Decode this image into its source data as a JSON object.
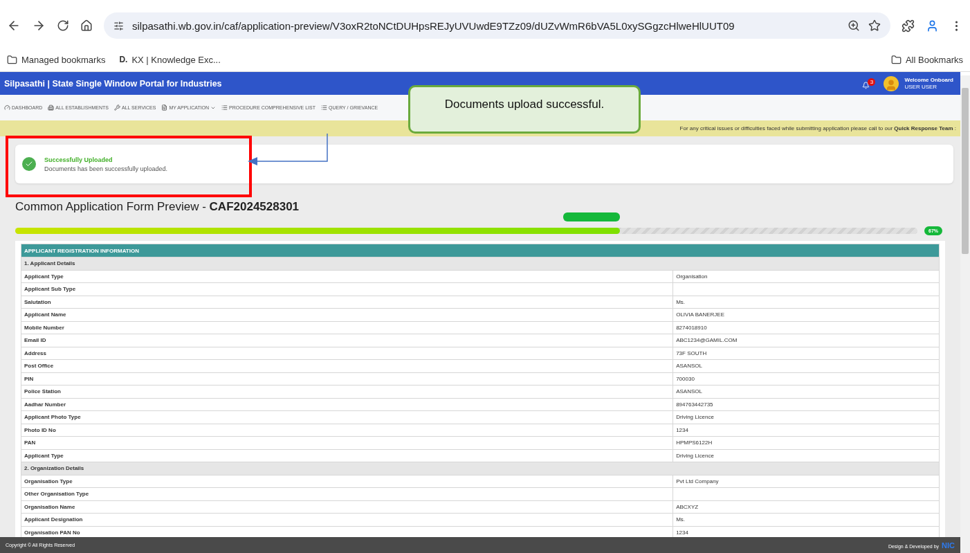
{
  "browser": {
    "url": "silpasathi.wb.gov.in/caf/application-preview/V3oxR2toNCtDUHpsREJyUVUwdE9TZz09/dUZvWmR6bVA5L0xySGgzcHlweHlUUT09",
    "bookmarks": [
      {
        "label": "Managed bookmarks",
        "kind": "folder"
      },
      {
        "label": "KX | Knowledge Exc...",
        "kind": "site",
        "logo_text": "D."
      }
    ],
    "all_bookmarks": "All Bookmarks"
  },
  "header": {
    "title": "Silpasathi | State Single Window Portal for Industries",
    "notification_count": "3",
    "welcome": "Welcome Onboard",
    "user": "USER USER"
  },
  "nav": [
    {
      "label": "DASHBOARD",
      "kind": "dashboard"
    },
    {
      "label": "ALL ESTABLISHMENTS",
      "kind": "building"
    },
    {
      "label": "ALL SERVICES",
      "kind": "wrench"
    },
    {
      "label": "MY APPLICATION",
      "kind": "doc",
      "dropdown": true
    },
    {
      "label": "PROCEDURE COMPREHENSIVE LIST",
      "kind": "list"
    },
    {
      "label": "QUERY / GRIEVANCE",
      "kind": "list"
    }
  ],
  "banner": {
    "text": "For any critical issues or difficulties faced while submitting application please call to our **Quick Response Team** :"
  },
  "alert": {
    "title": "Successfully Uploaded",
    "message": "Documents has been successfully uploaded."
  },
  "callout": {
    "text": "Documents upload successful."
  },
  "page_title": {
    "text": "Common Application Form Preview - ",
    "id": "CAF2024528301"
  },
  "progress": {
    "level": 0.67,
    "reading": "67%"
  },
  "table": {
    "rows": [
      {
        "kind": "header",
        "label": "APPLICANT REGISTRATION INFORMATION"
      },
      {
        "kind": "section",
        "label": "1. Applicant Details"
      },
      {
        "kind": "field",
        "label": "Applicant Type",
        "value": "Organisation"
      },
      {
        "kind": "field",
        "label": "Applicant Sub Type"
      },
      {
        "kind": "field",
        "label": "Salutation",
        "value": "Ms."
      },
      {
        "kind": "field",
        "label": "Applicant Name",
        "value": "OLIVIA BANERJEE"
      },
      {
        "kind": "field",
        "label": "Mobile Number",
        "value": "8274018910"
      },
      {
        "kind": "field",
        "label": "Email ID",
        "value": "ABC1234@GAMIL.COM"
      },
      {
        "kind": "field",
        "label": "Address",
        "value": "73F SOUTH"
      },
      {
        "kind": "field",
        "label": "Post Office",
        "value": "ASANSOL"
      },
      {
        "kind": "field",
        "label": "PIN",
        "value": "700030"
      },
      {
        "kind": "field",
        "label": "Police Station",
        "value": "ASANSOL"
      },
      {
        "kind": "field",
        "label": "Aadhar Number",
        "value": "894763442735"
      },
      {
        "kind": "field",
        "label": "Applicant Photo Type",
        "value": "Driving Licence"
      },
      {
        "kind": "field",
        "label": "Photo ID No",
        "value": "1234"
      },
      {
        "kind": "field",
        "label": "PAN",
        "value": "HPMPS6122H"
      },
      {
        "kind": "field",
        "label": "Applicant Type",
        "value": "Driving Licence"
      },
      {
        "kind": "section",
        "label": "2. Organization Details"
      },
      {
        "kind": "field",
        "label": "Organisation Type",
        "value": "Pvt Ltd Company"
      },
      {
        "kind": "field",
        "label": "Other Organisation Type"
      },
      {
        "kind": "field",
        "label": "Organisation Name",
        "value": "ABCXYZ"
      },
      {
        "kind": "field",
        "label": "Applicant Designation",
        "value": "Ms."
      },
      {
        "kind": "field",
        "label": "Organisation PAN No",
        "value": "1234"
      }
    ]
  },
  "footer": {
    "copyright": "Copyright © All Rights Reserved",
    "credit": "Design & Developed by",
    "logo": "NIC"
  }
}
